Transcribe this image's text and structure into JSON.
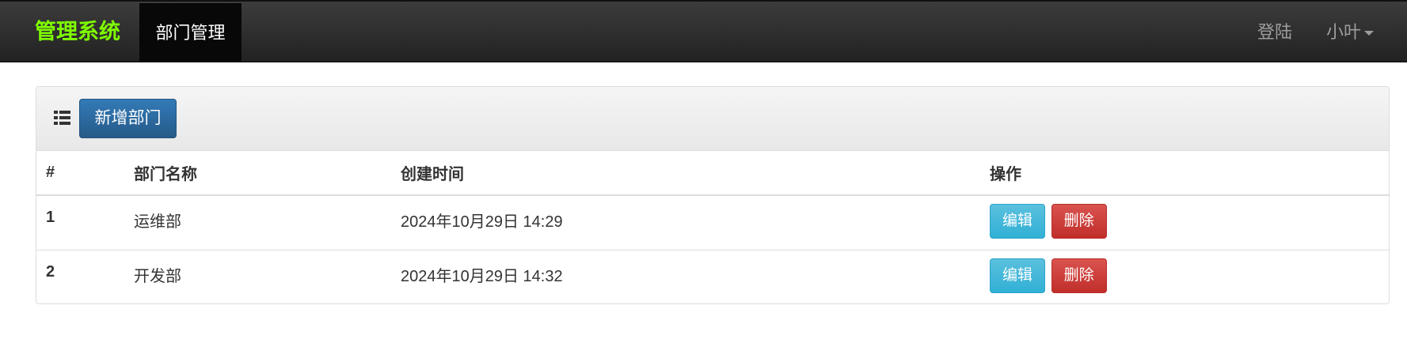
{
  "navbar": {
    "brand": "管理系统",
    "active_item": "部门管理",
    "login": "登陆",
    "user": "小叶",
    "brand_color": "#7fff00"
  },
  "panel": {
    "list_icon": "list-icon",
    "add_button": "新增部门"
  },
  "table": {
    "headers": [
      "#",
      "部门名称",
      "创建时间",
      "操作"
    ],
    "rows": [
      {
        "index": "1",
        "name": "运维部",
        "created": "2024年10月29日 14:29",
        "edit": "编辑",
        "delete": "删除"
      },
      {
        "index": "2",
        "name": "开发部",
        "created": "2024年10月29日 14:32",
        "edit": "编辑",
        "delete": "删除"
      }
    ]
  },
  "colors": {
    "navbar_bg": "#222222",
    "primary": "#337ab7",
    "info": "#5bc0de",
    "danger": "#d9534f"
  }
}
